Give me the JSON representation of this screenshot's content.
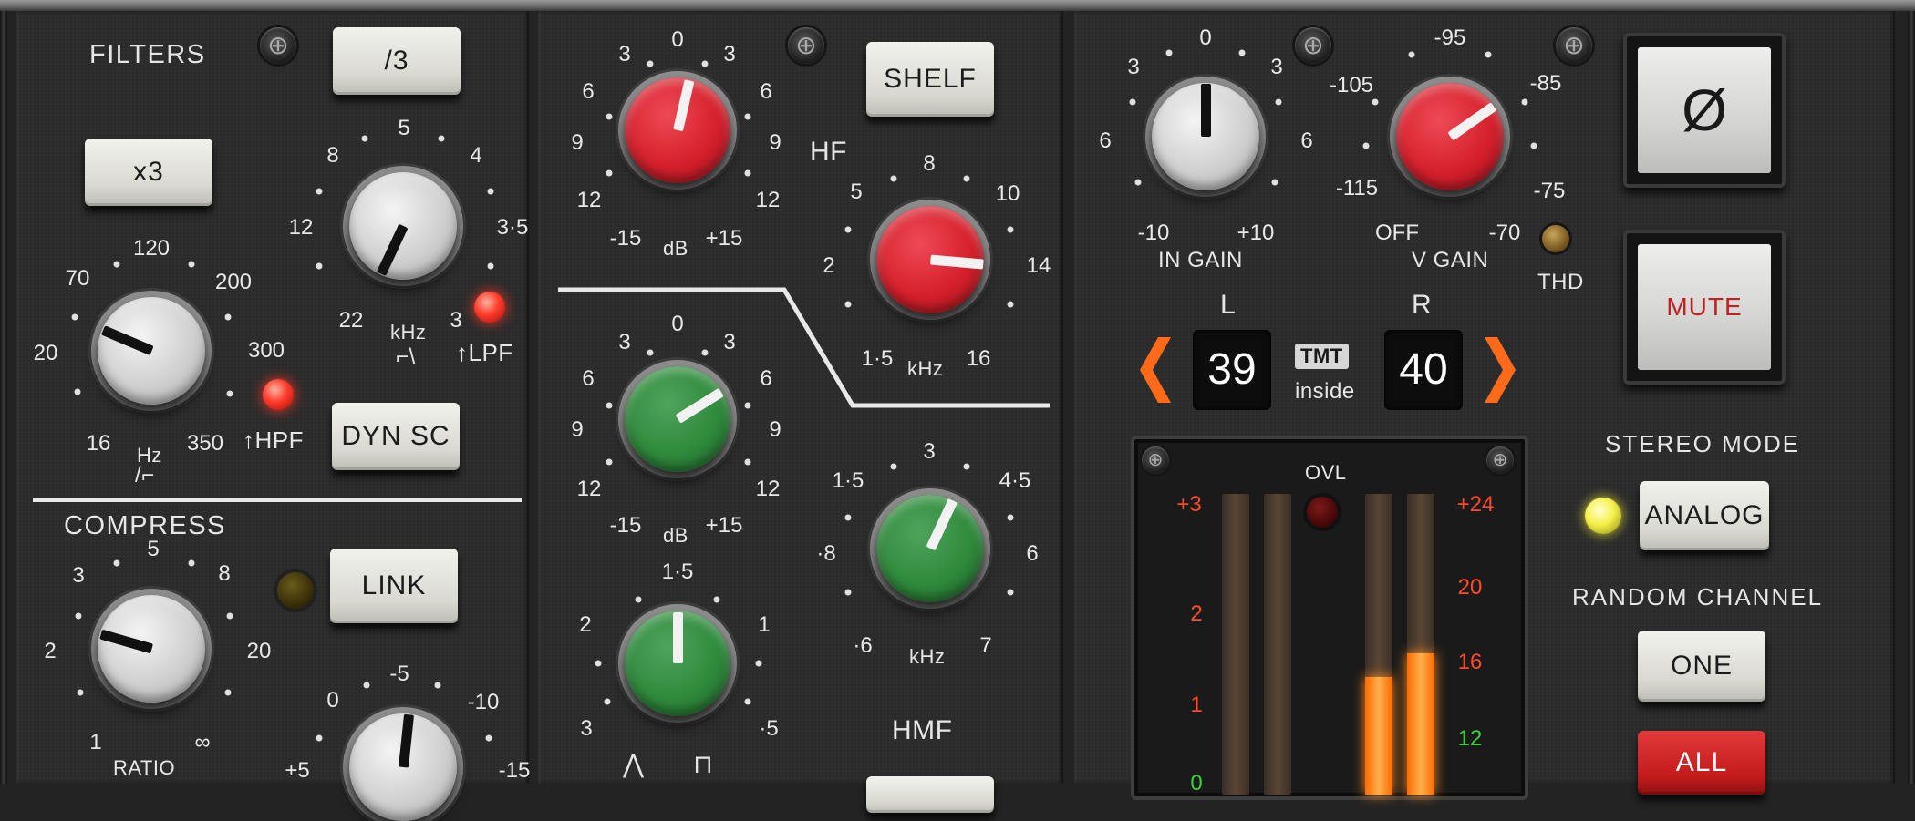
{
  "filters": {
    "title": "FILTERS",
    "btn_div3": "/3",
    "btn_x3": "x3",
    "hpf_ticks": [
      "120",
      "70",
      "200",
      "20",
      "300",
      "16",
      "350"
    ],
    "hpf_unit": "Hz",
    "hpf_label": "HPF",
    "lpf_ticks": [
      "5",
      "8",
      "4",
      "12",
      "3·5",
      "22",
      "3"
    ],
    "lpf_unit": "kHz",
    "lpf_label": "LPF",
    "btn_dyn_sc": "DYN SC"
  },
  "compress": {
    "title": "COMPRESS",
    "btn_link": "LINK",
    "ratio_ticks": [
      "5",
      "3",
      "8",
      "2",
      "20",
      "1",
      "∞"
    ],
    "ratio_label": "RATIO",
    "thresh_ticks": [
      "-5",
      "0",
      "-10",
      "+5",
      "-15"
    ]
  },
  "eq": {
    "btn_shelf": "SHELF",
    "hf_label": "HF",
    "hf_gain_ticks": [
      "0",
      "3",
      "3",
      "6",
      "6",
      "9",
      "9",
      "12",
      "12",
      "-15",
      "+15"
    ],
    "hf_gain_unit": "dB",
    "hf_freq_ticks": [
      "8",
      "5",
      "10",
      "2",
      "14",
      "1·5",
      "16"
    ],
    "hf_freq_unit": "kHz",
    "hmf_gain_ticks": [
      "0",
      "3",
      "3",
      "6",
      "6",
      "9",
      "9",
      "12",
      "12",
      "-15",
      "+15"
    ],
    "hmf_gain_unit": "dB",
    "hmf_freq_ticks": [
      "3",
      "1·5",
      "4·5",
      "·8",
      "6",
      "·6",
      "7"
    ],
    "hmf_freq_unit": "kHz",
    "q_ticks": [
      "1·5",
      "2",
      "1",
      "3",
      "·5"
    ],
    "hmf_label": "HMF"
  },
  "output": {
    "in_gain_ticks": [
      "0",
      "3",
      "3",
      "6",
      "6",
      "-10",
      "+10"
    ],
    "in_gain_label": "IN GAIN",
    "v_gain_ticks": [
      "-95",
      "-105",
      "-85",
      "-115",
      "-75",
      "OFF",
      "-70"
    ],
    "v_gain_label": "V GAIN",
    "thd_label": "THD",
    "btn_phase": "Ø",
    "btn_mute": "MUTE",
    "channel_l_label": "L",
    "channel_r_label": "R",
    "channel_l_value": "39",
    "channel_r_value": "40",
    "tmt_logo": "TMT",
    "tmt_inside": "inside",
    "ovl_label": "OVL",
    "meter_left_scale": [
      "+3",
      "2",
      "1",
      "0"
    ],
    "meter_right_scale": [
      "+24",
      "20",
      "16",
      "12"
    ],
    "meter_levels": {
      "bar3": 0.39,
      "bar4": 0.47
    },
    "stereo_mode_label": "STEREO MODE",
    "btn_analog": "ANALOG",
    "random_channel_label": "RANDOM CHANNEL",
    "btn_one": "ONE",
    "btn_all": "ALL"
  },
  "colors": {
    "panel": "#2b2b2b",
    "knob_red": "#d4202c",
    "knob_green": "#2f8a3c",
    "led_red": "#ff3b2a",
    "led_yellow": "#f5f04a",
    "meter_orange": "#ff8a1e",
    "scale_red": "#ff4a2a",
    "scale_green": "#3bd13b",
    "arrow_orange": "#ff6a1a"
  }
}
